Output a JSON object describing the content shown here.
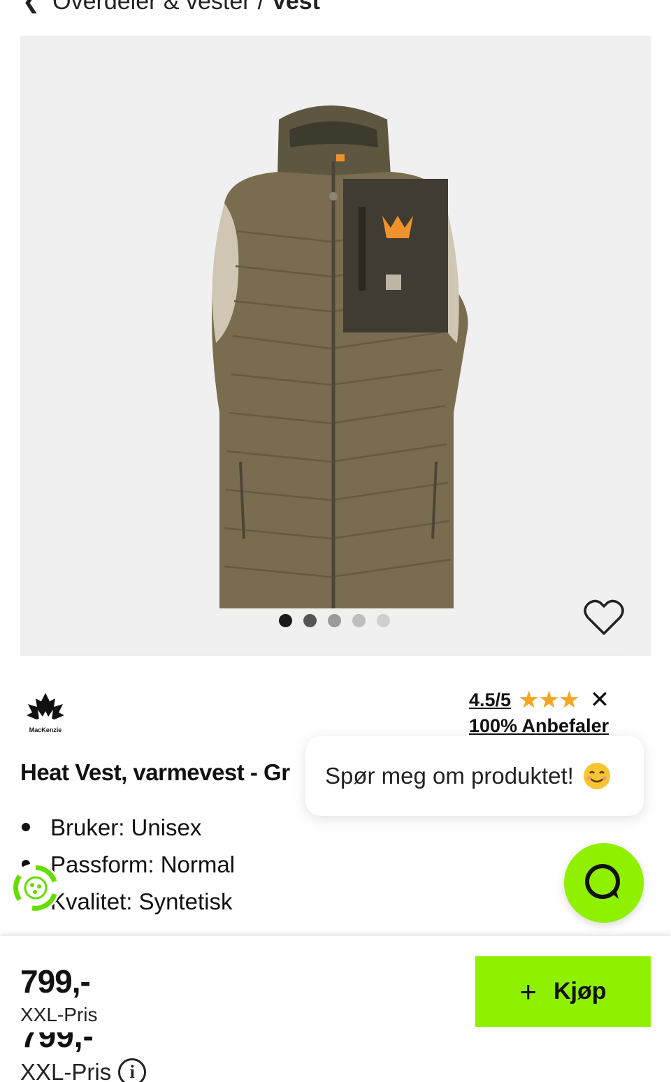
{
  "breadcrumb": {
    "parent": "Overdeler & vester",
    "separator": "/",
    "current": "Vest"
  },
  "gallery": {
    "dot_count": 5,
    "active_index": 0,
    "dot_colors": [
      "#1a1a1a",
      "#555555",
      "#9a9a9a",
      "#bdbdbd",
      "#cfcfcf"
    ]
  },
  "brand": {
    "logo_text": "MacKenzie"
  },
  "rating": {
    "score": "4.5/5",
    "stars": "★★★",
    "close_glyph": "✕",
    "recommend": "100% Anbefaler"
  },
  "product": {
    "title": "Heat Vest, varmevest - Gr",
    "features": [
      "Bruker: Unisex",
      "Passform: Normal",
      "Kvalitet: Syntetisk"
    ]
  },
  "chat": {
    "prompt": "Spør meg om produktet!",
    "emoji": "smiling-face-icon"
  },
  "purchase": {
    "price": "799,-",
    "price_label": "XXL-Pris",
    "price_label_2": "XXL-Pris",
    "info_glyph": "i",
    "buy_plus": "+",
    "buy_label": "Kjøp"
  },
  "colors": {
    "accent_green": "#8ff000",
    "star_orange": "#f5a623",
    "vest_olive": "#7a6c4f",
    "vest_dark": "#403b33"
  }
}
